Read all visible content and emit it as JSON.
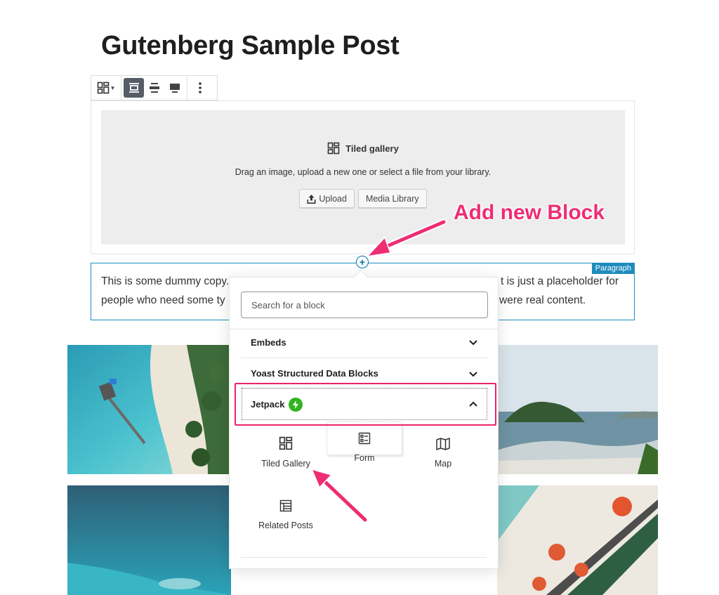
{
  "post": {
    "title": "Gutenberg Sample Post"
  },
  "toolbar": {
    "block_type_icon": "tiled-gallery-icon",
    "align_buttons": [
      "align-wide-icon",
      "align-center-icon",
      "align-full-icon"
    ],
    "active_align": "align-wide-icon",
    "more_icon": "more-vertical-icon"
  },
  "gallery_block": {
    "title": "Tiled gallery",
    "instructions": "Drag an image, upload a new one or select a file from your library.",
    "upload_label": "Upload",
    "media_library_label": "Media Library"
  },
  "paragraph_block": {
    "badge": "Paragraph",
    "line1_left": "This is some dummy copy. Y",
    "line1_right": "t is just a placeholder for",
    "line2_left": "people who need some ty",
    "line2_right": "were real content."
  },
  "inserter": {
    "search_placeholder": "Search for a block",
    "panels": {
      "embeds": "Embeds",
      "yoast": "Yoast Structured Data Blocks",
      "jetpack": "Jetpack"
    },
    "blocks": {
      "tiled_gallery": "Tiled Gallery",
      "form": "Form",
      "map": "Map",
      "related_posts": "Related Posts"
    }
  },
  "annotation": {
    "text": "Add new Block",
    "color": "#ee2d73"
  },
  "colors": {
    "accent": "#0073aa",
    "paragraph_border": "#1e8cbe",
    "jetpack_green": "#2fb41f",
    "highlight": "#e9246a"
  }
}
